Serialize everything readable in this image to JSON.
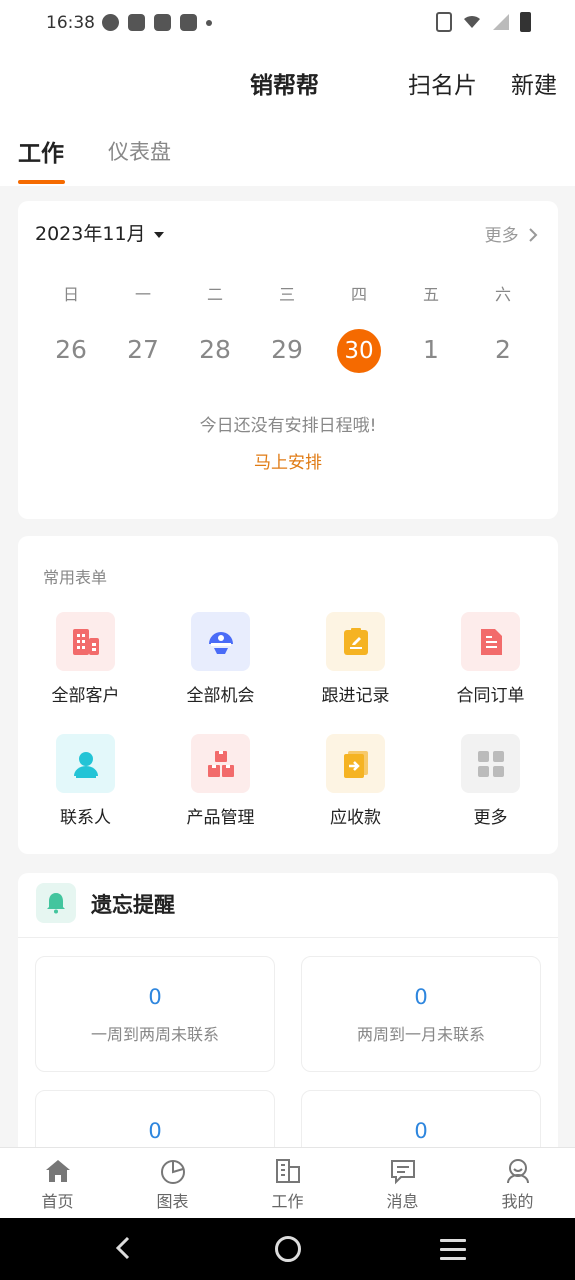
{
  "status": {
    "time": "16:38"
  },
  "header": {
    "title": "销帮帮",
    "scan_label": "扫名片",
    "new_label": "新建"
  },
  "tabs": [
    {
      "label": "工作"
    },
    {
      "label": "仪表盘"
    }
  ],
  "calendar": {
    "month": "2023年11月",
    "more": "更多",
    "weekdays": [
      "日",
      "一",
      "二",
      "三",
      "四",
      "五",
      "六"
    ],
    "days": [
      "26",
      "27",
      "28",
      "29",
      "30",
      "1",
      "2"
    ],
    "empty_text": "今日还没有安排日程哦!",
    "arrange_link": "马上安排"
  },
  "forms": {
    "title": "常用表单",
    "items": [
      {
        "label": "全部客户",
        "icon": "building-icon",
        "color": "#f26b6b"
      },
      {
        "label": "全部机会",
        "icon": "opportunity-icon",
        "color": "#4a6cf7"
      },
      {
        "label": "跟进记录",
        "icon": "notepad-icon",
        "color": "#f5b323"
      },
      {
        "label": "合同订单",
        "icon": "contract-icon",
        "color": "#f26b6b"
      },
      {
        "label": "联系人",
        "icon": "contact-icon",
        "color": "#23c4d6"
      },
      {
        "label": "产品管理",
        "icon": "product-icon",
        "color": "#f26b6b"
      },
      {
        "label": "应收款",
        "icon": "receivable-icon",
        "color": "#f5b323"
      },
      {
        "label": "更多",
        "icon": "grid-icon",
        "color": "#bbbbbb"
      }
    ]
  },
  "reminders": {
    "title": "遗忘提醒",
    "stats": [
      {
        "value": "0",
        "label": "一周到两周未联系"
      },
      {
        "value": "0",
        "label": "两周到一月未联系"
      },
      {
        "value": "0",
        "label": ""
      },
      {
        "value": "0",
        "label": ""
      }
    ]
  },
  "bottom_nav": [
    {
      "label": "首页",
      "icon": "home-icon"
    },
    {
      "label": "图表",
      "icon": "chart-icon"
    },
    {
      "label": "工作",
      "icon": "work-icon"
    },
    {
      "label": "消息",
      "icon": "message-icon"
    },
    {
      "label": "我的",
      "icon": "profile-icon"
    }
  ]
}
